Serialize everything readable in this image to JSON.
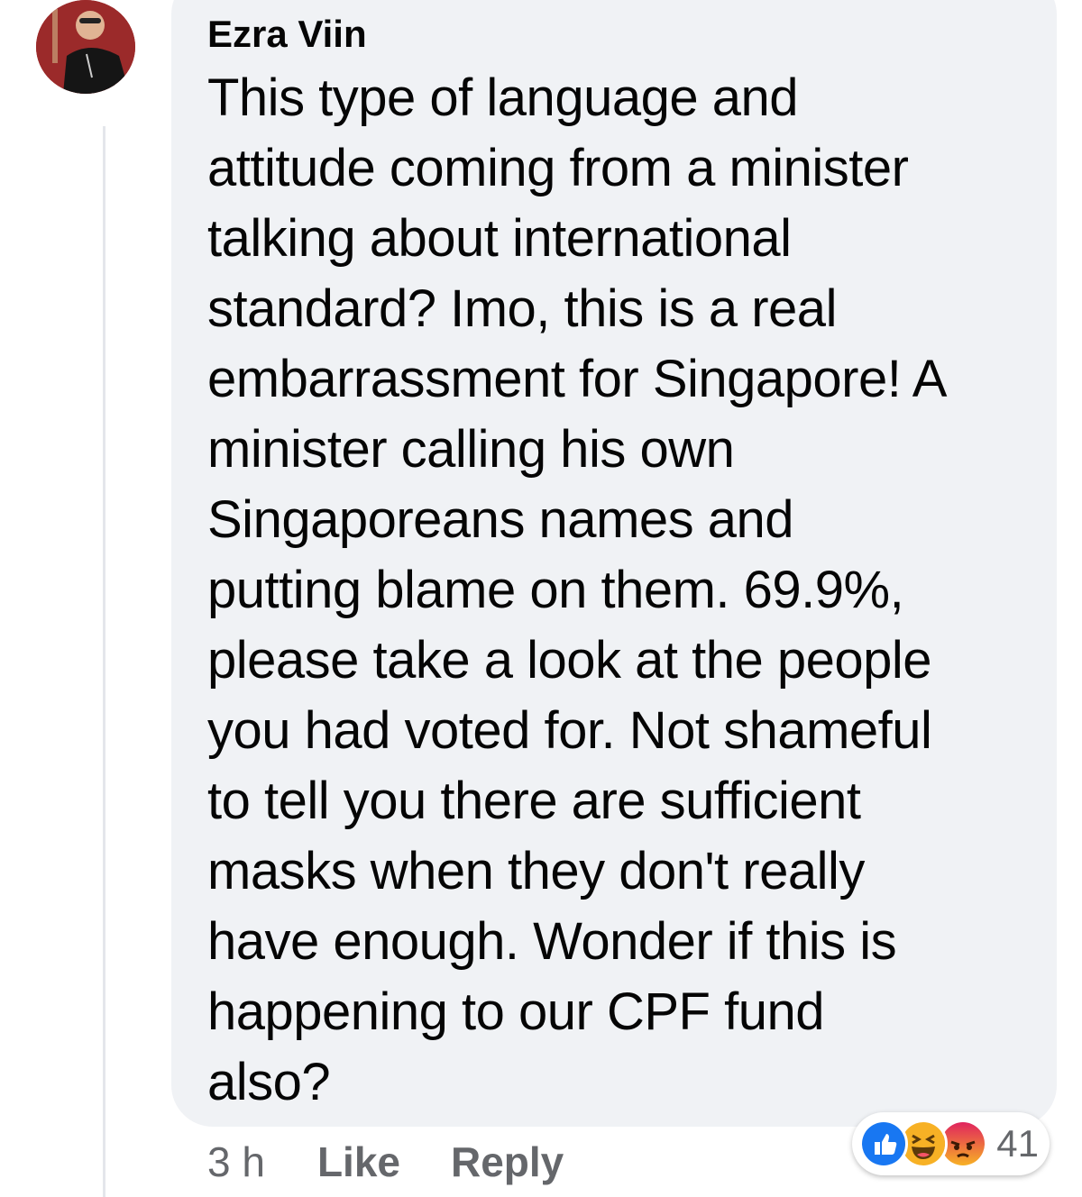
{
  "comment": {
    "author": "Ezra Viin",
    "text": "This type of language and\nattitude coming from a minister\ntalking about international\nstandard? Imo, this is a real\nembarrassment for Singapore! A\nminister calling his own\nSingaporeans names and\nputting blame on them. 69.9%,\nplease take a look at the people\nyou had voted for. Not shameful\nto tell you there are sufficient\nmasks when they don't really\nhave enough. Wonder if this is\nhappening to our CPF fund\nalso?",
    "time": "3 h",
    "like_label": "Like",
    "reply_label": "Reply"
  },
  "reactions": {
    "icons": [
      "like-icon",
      "haha-icon",
      "angry-icon"
    ],
    "count": "41"
  },
  "colors": {
    "bubble": "#f0f2f5",
    "like_blue": "#1877f2",
    "haha_yellow": "#f7b125",
    "angry_orange": "#e9710f",
    "muted_text": "#65676b"
  }
}
